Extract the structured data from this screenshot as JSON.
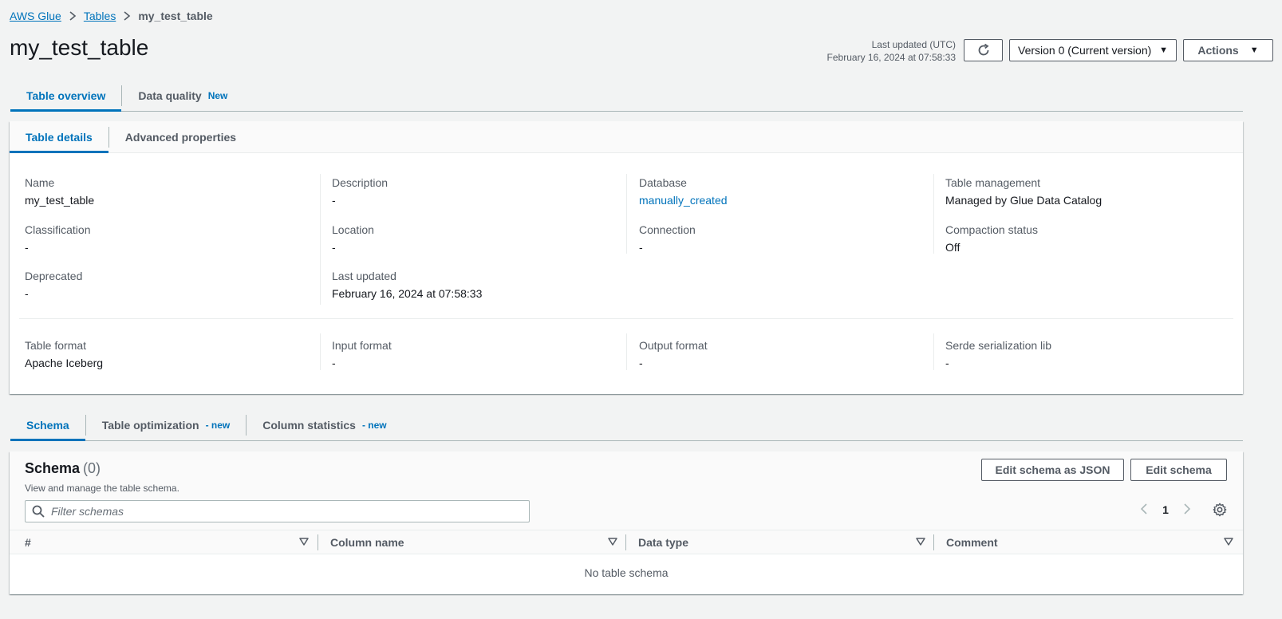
{
  "breadcrumb": {
    "items": [
      "AWS Glue",
      "Tables"
    ],
    "current": "my_test_table"
  },
  "page": {
    "title": "my_test_table",
    "last_updated_label": "Last updated (UTC)",
    "last_updated_value": "February 16, 2024 at 07:58:33"
  },
  "toolbar": {
    "version_label": "Version 0 (Current version)",
    "actions_label": "Actions"
  },
  "main_tabs": [
    {
      "label": "Table overview",
      "active": true
    },
    {
      "label": "Data quality",
      "badge": "New",
      "active": false
    }
  ],
  "detail_tabs": [
    {
      "label": "Table details",
      "active": true
    },
    {
      "label": "Advanced properties",
      "active": false
    }
  ],
  "details": {
    "name": {
      "label": "Name",
      "value": "my_test_table"
    },
    "description": {
      "label": "Description",
      "value": "-"
    },
    "database": {
      "label": "Database",
      "value": "manually_created"
    },
    "table_management": {
      "label": "Table management",
      "value": "Managed by Glue Data Catalog"
    },
    "classification": {
      "label": "Classification",
      "value": "-"
    },
    "location": {
      "label": "Location",
      "value": "-"
    },
    "connection": {
      "label": "Connection",
      "value": "-"
    },
    "compaction_status": {
      "label": "Compaction status",
      "value": "Off"
    },
    "deprecated": {
      "label": "Deprecated",
      "value": "-"
    },
    "last_updated": {
      "label": "Last updated",
      "value": "February 16, 2024 at 07:58:33"
    },
    "table_format": {
      "label": "Table format",
      "value": "Apache Iceberg"
    },
    "input_format": {
      "label": "Input format",
      "value": "-"
    },
    "output_format": {
      "label": "Output format",
      "value": "-"
    },
    "serde_lib": {
      "label": "Serde serialization lib",
      "value": "-"
    }
  },
  "schema_tabs": [
    {
      "label": "Schema",
      "active": true
    },
    {
      "label": "Table optimization",
      "badge": "- new",
      "active": false
    },
    {
      "label": "Column statistics",
      "badge": "- new",
      "active": false
    }
  ],
  "schema": {
    "title": "Schema",
    "count": "(0)",
    "description": "View and manage the table schema.",
    "edit_json_label": "Edit schema as JSON",
    "edit_label": "Edit schema",
    "filter_placeholder": "Filter schemas",
    "page_number": "1",
    "columns": [
      "#",
      "Column name",
      "Data type",
      "Comment"
    ],
    "empty_message": "No table schema"
  }
}
